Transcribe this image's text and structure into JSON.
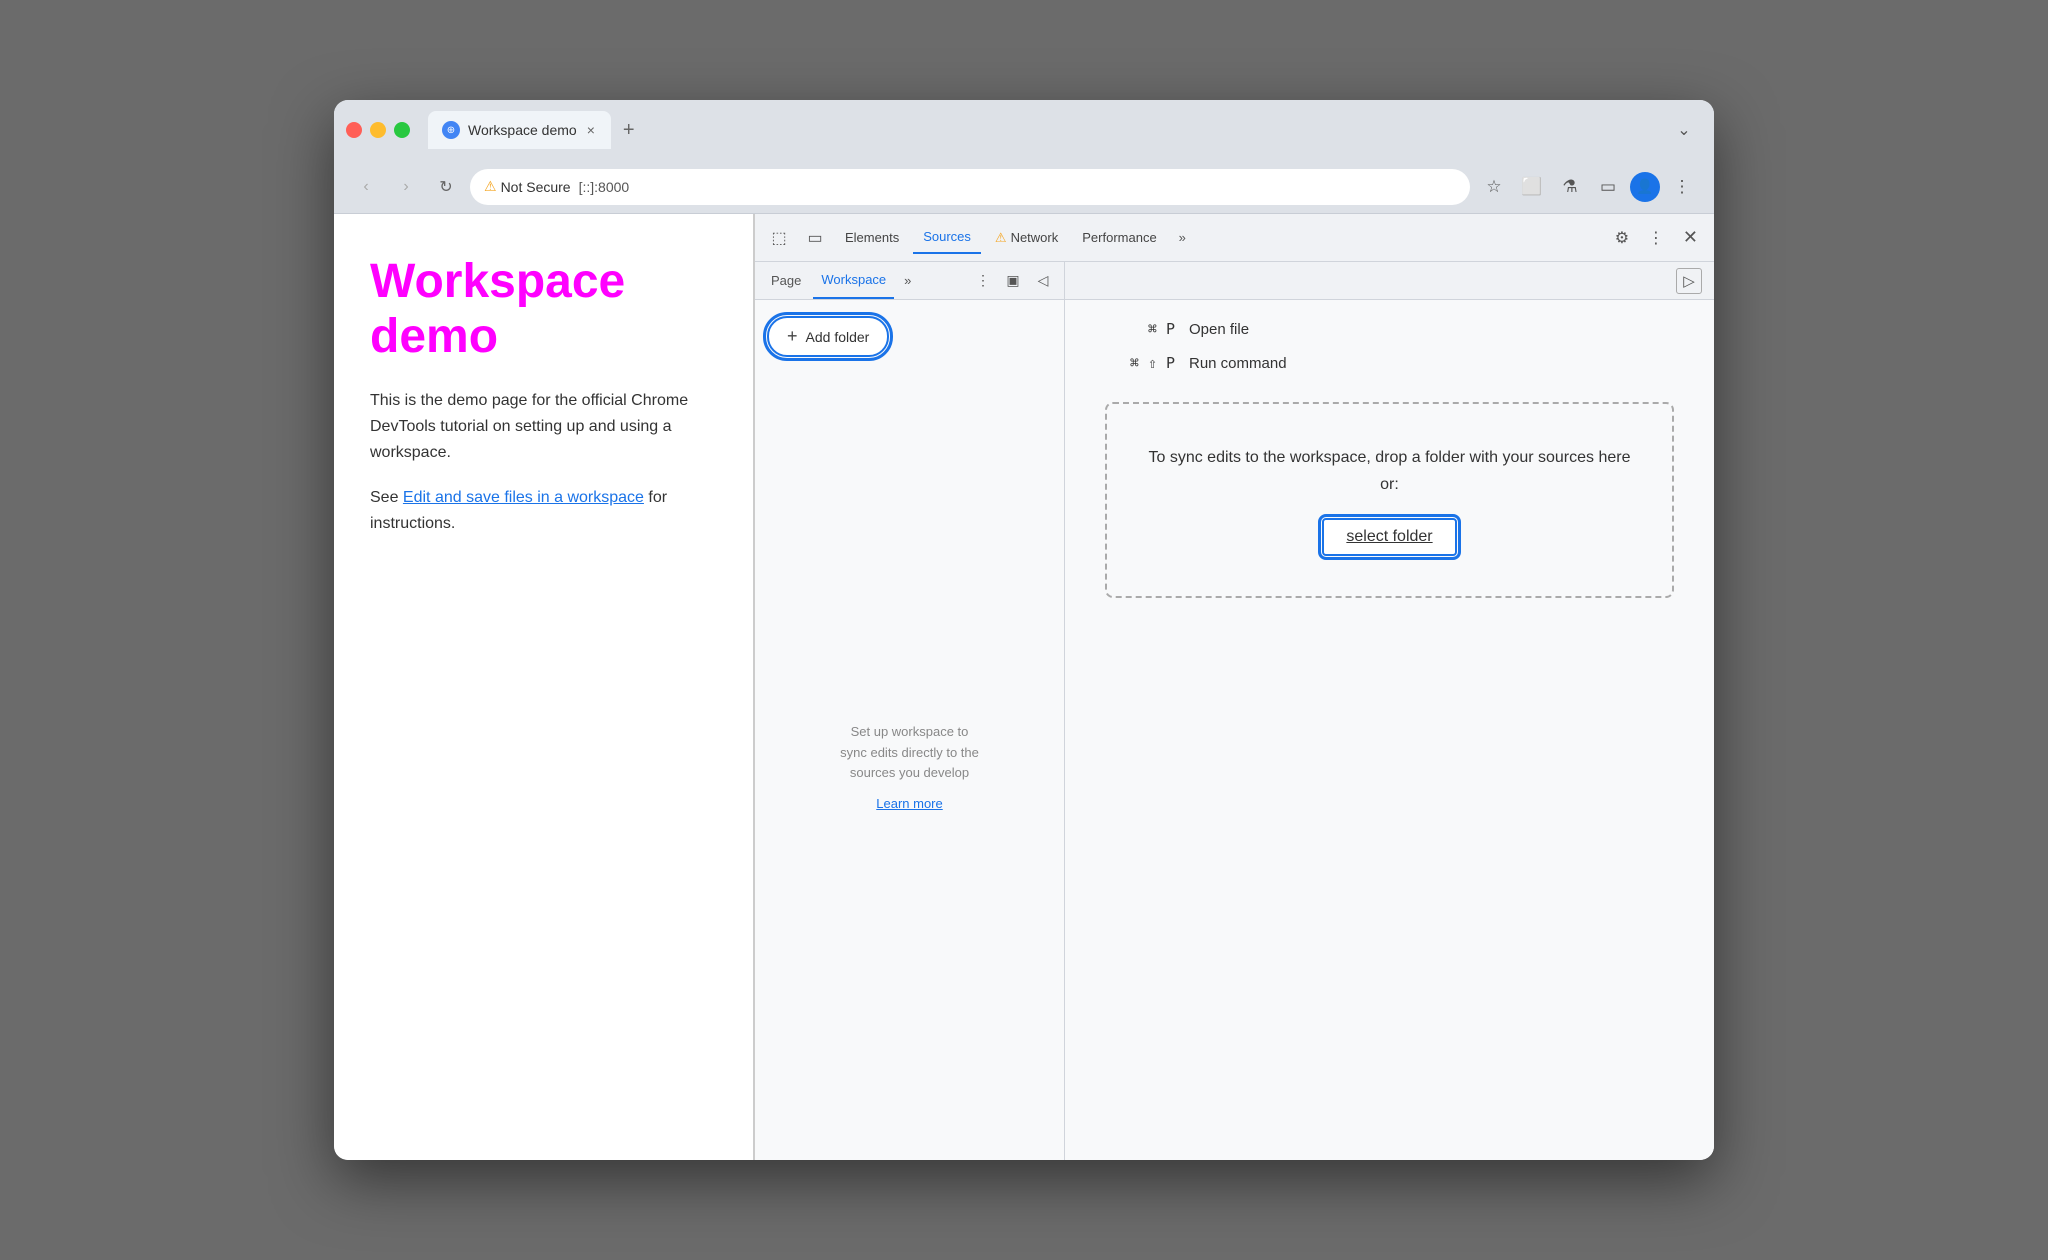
{
  "browser": {
    "tab_title": "Workspace demo",
    "tab_close": "×",
    "tab_new": "+",
    "address": {
      "not_secure_label": "Not Secure",
      "url": "[::]:8000"
    },
    "traffic_lights": {
      "close": "close",
      "minimize": "minimize",
      "maximize": "maximize"
    },
    "nav": {
      "back": "‹",
      "forward": "›",
      "refresh": "↻"
    },
    "title_bar_chevron": "⌄"
  },
  "page": {
    "title": "Workspace demo",
    "description": "This is the demo page for the official Chrome DevTools tutorial on setting up and using a workspace.",
    "see_prefix": "See ",
    "link_text": "Edit and save files in a workspace",
    "see_suffix": " for instructions."
  },
  "devtools": {
    "toolbar": {
      "inspect_icon": "⬚",
      "device_icon": "▭",
      "elements_label": "Elements",
      "sources_label": "Sources",
      "network_label": "Network",
      "network_warning_icon": "⚠",
      "performance_label": "Performance",
      "more_tabs": "»",
      "gear_label": "⚙",
      "more_options": "⋮",
      "close_label": "✕"
    },
    "left_panel": {
      "page_tab": "Page",
      "workspace_tab": "Workspace",
      "more_tabs": "»",
      "more_options": "⋮",
      "panel_icon": "▣",
      "collapse_icon": "◁",
      "add_folder_label": "+ Add folder",
      "add_folder_plus": "+",
      "add_folder_text": "Add folder",
      "empty_msg_line1": "Set up workspace to",
      "empty_msg_line2": "sync edits directly to the",
      "empty_msg_line3": "sources you develop",
      "learn_more": "Learn more"
    },
    "right_panel": {
      "panel_icon": "▷",
      "shortcuts": [
        {
          "keys": "⌘ P",
          "label": "Open file"
        },
        {
          "keys": "⌘ ⇧ P",
          "label": "Run command"
        }
      ],
      "drop_zone_text": "To sync edits to the workspace, drop a folder with your sources here or:",
      "select_folder_btn": "select folder"
    }
  }
}
